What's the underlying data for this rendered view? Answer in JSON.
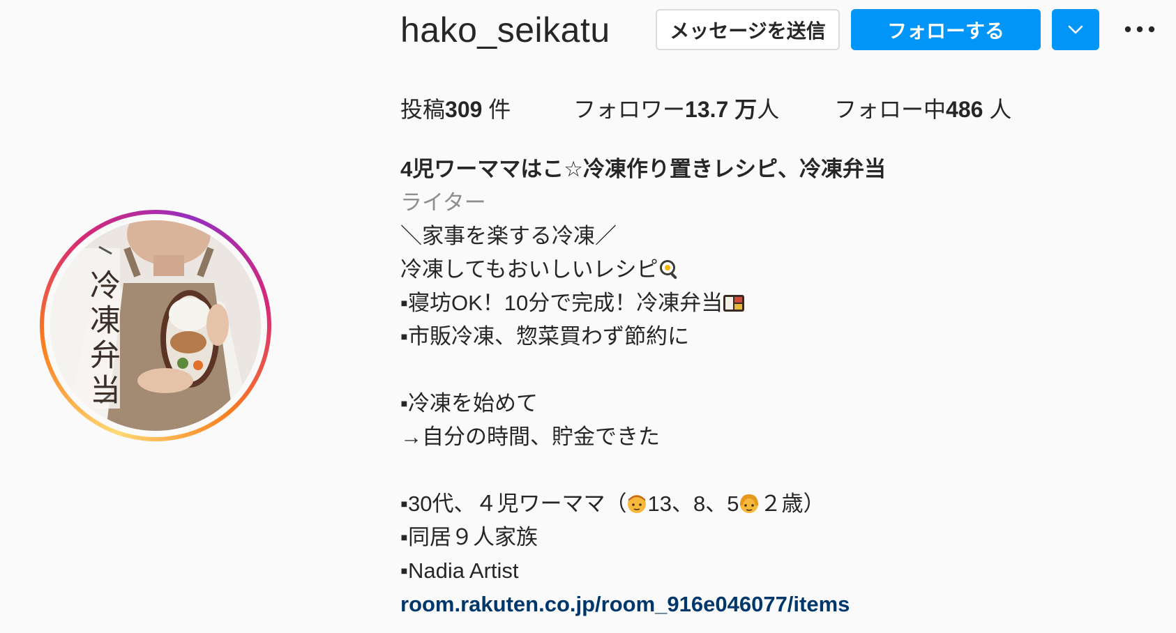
{
  "profile": {
    "username": "hako_seikatu",
    "avatar_label": "冷凍弁当"
  },
  "actions": {
    "message_label": "メッセージを送信",
    "follow_label": "フォローする",
    "dropdown_icon": "chevron-down-icon",
    "more_icon": "more-icon"
  },
  "stats": {
    "posts_label": "投稿",
    "posts_value": "309",
    "posts_unit": " 件",
    "followers_label": "フォロワー",
    "followers_value": "13.7 万",
    "followers_unit": "人",
    "following_label": "フォロー中",
    "following_value": "486",
    "following_unit": " 人"
  },
  "bio": {
    "name": "4児ワーママはこ☆冷凍作り置きレシピ、冷凍弁当",
    "category": "ライター",
    "lines": [
      "＼家事を楽する冷凍／",
      "冷凍してもおいしいレシピ",
      "▪寝坊OK！10分で完成！冷凍弁当",
      "▪市販冷凍、惣菜買わず節約に",
      "",
      "▪冷凍を始めて",
      "→自分の時間、貯金できた",
      "",
      "▪30代、４児ワーママ（",
      "13、8、5",
      "２歳）",
      "▪同居９人家族",
      "▪Nadia Artist"
    ],
    "link": "room.rakuten.co.jp/room_916e046077/items"
  },
  "colors": {
    "accent": "#0095f6",
    "link": "#00376b",
    "muted": "#8e8e8e",
    "text": "#262626"
  }
}
